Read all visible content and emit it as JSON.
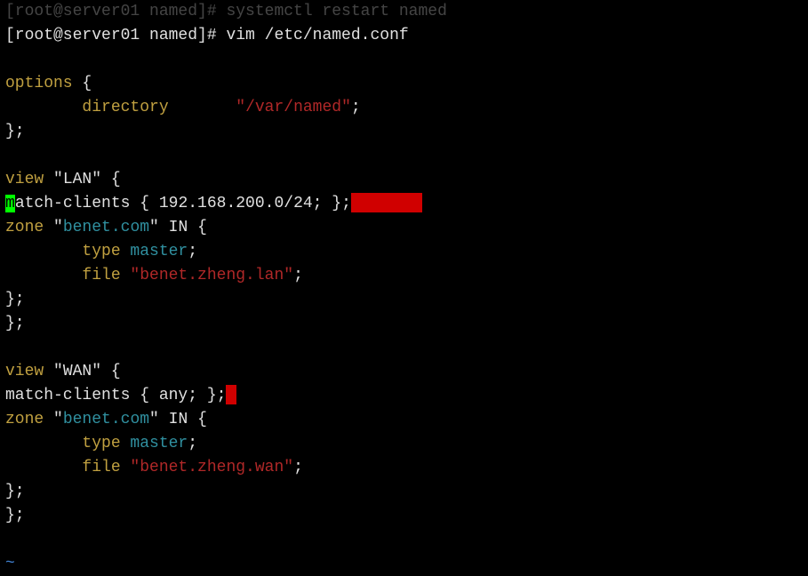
{
  "prompt_cutoff": "[root@server01 named]# systemctl restart named",
  "prompt_line": "[root@server01 named]# vim /etc/named.conf",
  "options_kw": "options",
  "brace_open": " {",
  "directory_kw": "        directory",
  "directory_val": "\"/var/named\"",
  "semi": ";",
  "close_brace": "};",
  "view_kw": "view",
  "lan_str": " \"LAN\"",
  "wan_str": " \"WAN\"",
  "match_m": "m",
  "match_rest": "atch-clients { 192.168.200.0/24; };",
  "match_wan": "match-clients { any; };",
  "zone_kw": "zone",
  "benet_str_open": " \"",
  "benet_name": "benet.com",
  "benet_str_close": "\"",
  "in_txt": " IN {",
  "type_kw": "        type",
  "master_kw": " master",
  "file_kw": "        file",
  "file_lan": " \"benet.zheng.lan\"",
  "file_wan": " \"benet.zheng.wan\"",
  "tilde": "~"
}
